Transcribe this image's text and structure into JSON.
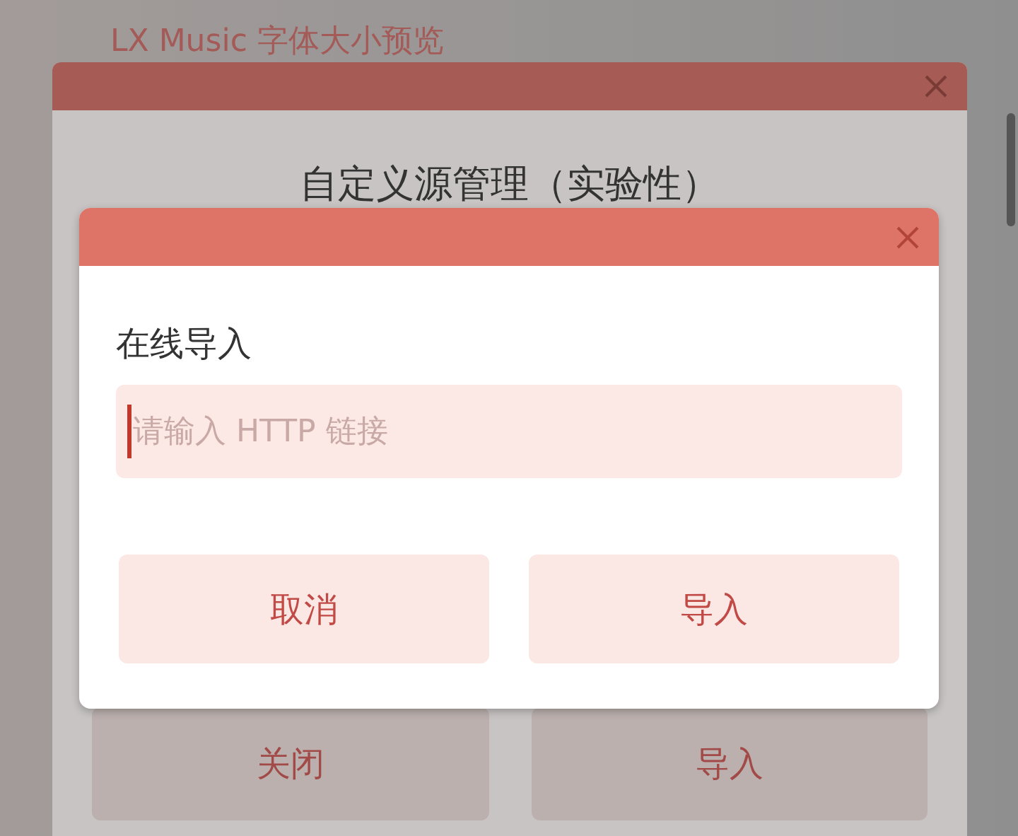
{
  "background": {
    "title": "LX Music 字体大小预览"
  },
  "back_dialog": {
    "title": "自定义源管理（实验性）",
    "buttons": [
      "关闭",
      "导入"
    ]
  },
  "import_dialog": {
    "title": "在线导入",
    "input": {
      "placeholder": "请输入 HTTP 链接",
      "focused": true
    },
    "buttons": [
      "取消",
      "导入"
    ]
  }
}
